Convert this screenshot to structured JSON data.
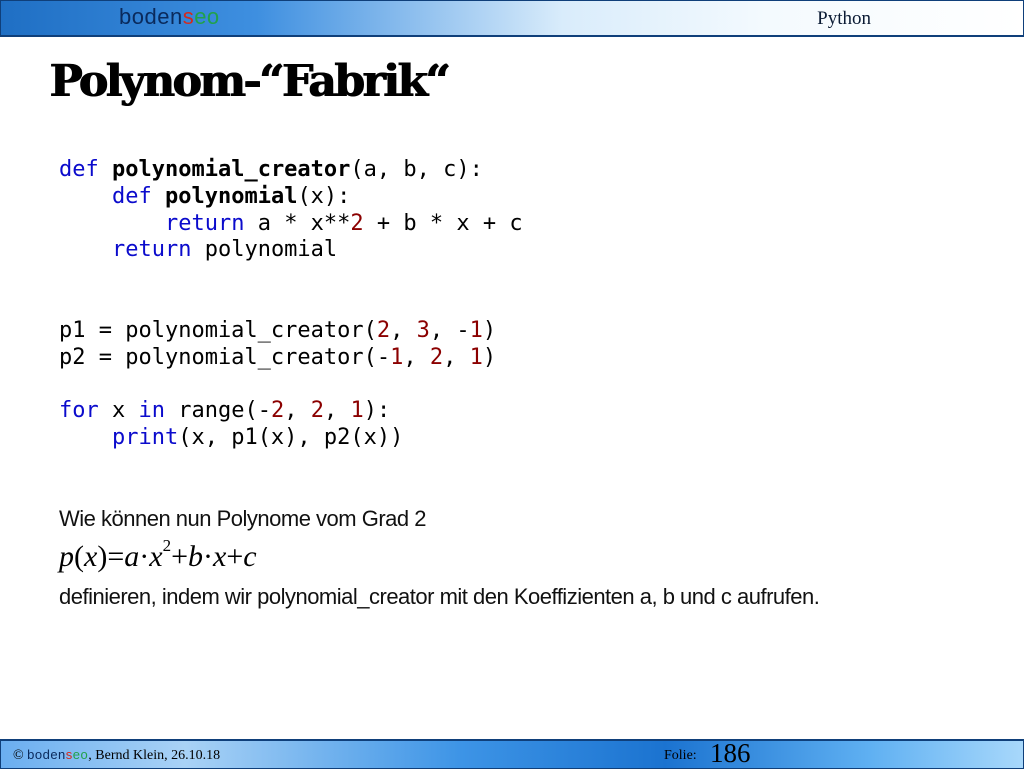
{
  "header": {
    "logo": {
      "part1": "boden",
      "part2": "s",
      "part3": "eo"
    },
    "section_title": "Python"
  },
  "slide": {
    "title": "Polynom-“Fabrik“",
    "code": {
      "l1_kw": "def",
      "l1_fn": "polynomial_creator",
      "l1_rest": "(a, b, c):",
      "l2_kw": "def",
      "l2_fn": "polynomial",
      "l2_rest": "(x):",
      "l3_kw": "return",
      "l3_a": " a * x**",
      "l3_n": "2",
      "l3_b": " + b * x + c",
      "l4_kw": "return",
      "l4_rest": " polynomial",
      "l5_a": "p1 = polynomial_creator(",
      "l5_n1": "2",
      "l5_s1": ", ",
      "l5_n2": "3",
      "l5_s2": ", -",
      "l5_n3": "1",
      "l5_e": ")",
      "l6_a": "p2 = polynomial_creator(-",
      "l6_n1": "1",
      "l6_s1": ", ",
      "l6_n2": "2",
      "l6_s2": ", ",
      "l6_n3": "1",
      "l6_e": ")",
      "l7_kw1": "for",
      "l7_a": " x ",
      "l7_kw2": "in",
      "l7_b": " range(-",
      "l7_n1": "2",
      "l7_s1": ", ",
      "l7_n2": "2",
      "l7_s2": ", ",
      "l7_n3": "1",
      "l7_e": "):",
      "l8_kw": "print",
      "l8_rest": "(x, p1(x), p2(x))"
    },
    "text_line1": "Wie können nun Polynome vom Grad 2",
    "formula": {
      "lhs": "p",
      "lp": "(",
      "var": "x",
      "rp": ")",
      "eq": "=",
      "a": "a",
      "dot1": "·",
      "x1": "x",
      "exp": "2",
      "plus1": "+",
      "b": "b",
      "dot2": "·",
      "x2": "x",
      "plus2": "+",
      "c": "c"
    },
    "text_line2": "definieren, indem wir polynomial_creator mit den Koeffizienten a, b und c aufrufen."
  },
  "footer": {
    "copyright": "© ",
    "logo": {
      "part1": "boden",
      "part2": "s",
      "part3": "eo"
    },
    "author_date": ", Bernd Klein, 26.10.18",
    "folie_label": "Folie:",
    "folie_number": "186"
  }
}
